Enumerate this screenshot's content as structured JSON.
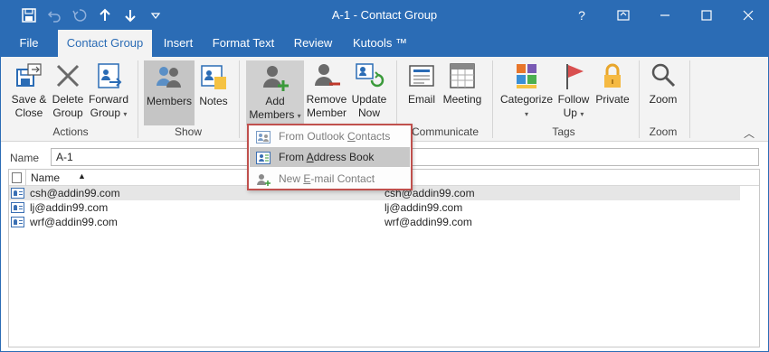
{
  "window": {
    "title": "A-1  -  Contact Group",
    "help": "?",
    "ribbon_display": "⊡",
    "minimize": "—",
    "maximize": "☐",
    "close": "✕"
  },
  "quick_access": {
    "save": "💾",
    "undo": "↶",
    "redo": "↷",
    "up": "🡑",
    "down": "🡓",
    "customize": "▿"
  },
  "tabs": [
    "File",
    "Contact Group",
    "Insert",
    "Format Text",
    "Review",
    "Kutools ™"
  ],
  "ribbon": {
    "actions": {
      "label": "Actions",
      "save_close": [
        "Save &",
        "Close"
      ],
      "delete_group": [
        "Delete",
        "Group"
      ],
      "forward_group": [
        "Forward",
        "Group"
      ]
    },
    "show": {
      "label": "Show",
      "members": "Members",
      "notes": "Notes"
    },
    "members": {
      "add_members": [
        "Add",
        "Members"
      ],
      "remove_member": [
        "Remove",
        "Member"
      ],
      "update_now": [
        "Update",
        "Now"
      ]
    },
    "communicate": {
      "label": "Communicate",
      "email": "Email",
      "meeting": "Meeting"
    },
    "tags": {
      "label": "Tags",
      "categorize": "Categorize",
      "follow_up": [
        "Follow",
        "Up"
      ],
      "private": "Private"
    },
    "zoom": {
      "label": "Zoom",
      "zoom": "Zoom"
    },
    "collapse": "︿"
  },
  "add_members_menu": {
    "items": [
      {
        "pre": "From Outlook ",
        "key": "C",
        "post": "ontacts"
      },
      {
        "pre": "From ",
        "key": "A",
        "post": "ddress Book"
      },
      {
        "pre": "New ",
        "key": "E",
        "post": "-mail Contact"
      }
    ]
  },
  "name_field": {
    "label": "Name",
    "value": "A-1"
  },
  "list": {
    "col_name": "Name",
    "sort_indicator": "▲",
    "rows": [
      {
        "name": "csh@addin99.com",
        "email": "csh@addin99.com"
      },
      {
        "name": "lj@addin99.com",
        "email": "lj@addin99.com"
      },
      {
        "name": "wrf@addin99.com",
        "email": "wrf@addin99.com"
      }
    ]
  }
}
